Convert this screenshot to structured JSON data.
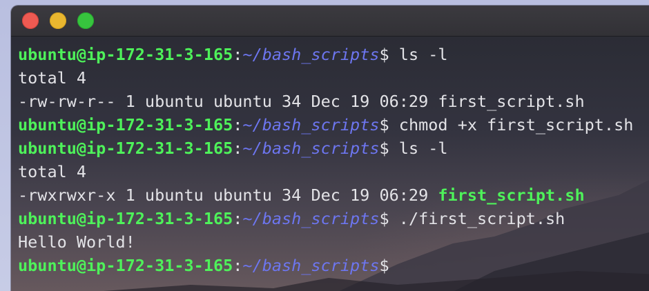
{
  "window": {
    "buttons": {
      "close": "close-button",
      "minimize": "minimize-button",
      "zoom": "zoom-button"
    }
  },
  "colors": {
    "prompt_user": "#4ef25a",
    "prompt_path": "#6d76f0",
    "text": "#e3e3e7",
    "executable": "#4ef25a"
  },
  "prompt": {
    "user_host": "ubuntu@ip-172-31-3-165",
    "colon": ":",
    "path": "~/bash_scripts",
    "symbol": "$"
  },
  "lines": [
    {
      "type": "prompt",
      "command": " ls -l"
    },
    {
      "type": "output",
      "text": "total 4"
    },
    {
      "type": "output",
      "text": "-rw-rw-r-- 1 ubuntu ubuntu 34 Dec 19 06:29 first_script.sh"
    },
    {
      "type": "prompt",
      "command": " chmod +x first_script.sh"
    },
    {
      "type": "prompt",
      "command": " ls -l"
    },
    {
      "type": "output",
      "text": "total 4"
    },
    {
      "type": "listing",
      "meta": "-rwxrwxr-x 1 ubuntu ubuntu 34 Dec 19 06:29 ",
      "filename": "first_script.sh"
    },
    {
      "type": "prompt",
      "command": " ./first_script.sh"
    },
    {
      "type": "output",
      "text": "Hello World!"
    },
    {
      "type": "prompt",
      "command": ""
    }
  ]
}
